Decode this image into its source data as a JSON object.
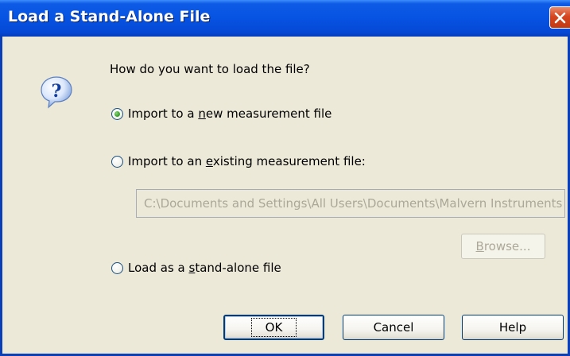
{
  "window": {
    "title": "Load a Stand-Alone File",
    "close_icon": "close-icon"
  },
  "dialog": {
    "icon": "question-icon",
    "prompt": "How do you want to load the file?",
    "options": [
      {
        "pre": "Import to a ",
        "accel": "n",
        "post": "ew measurement file",
        "checked": true
      },
      {
        "pre": "Import to an ",
        "accel": "e",
        "post": "xisting measurement file:",
        "checked": false
      },
      {
        "pre": "Load as a ",
        "accel": "s",
        "post": "tand-alone file",
        "checked": false
      }
    ],
    "path_value": "C:\\Documents and Settings\\All Users\\Documents\\Malvern Instruments",
    "browse": {
      "accel": "B",
      "rest": "rowse..."
    },
    "ok_label": "OK",
    "cancel_label": "Cancel",
    "help_label": "Help"
  },
  "colors": {
    "titlebar": "#0753e2",
    "dialog_bg": "#ece9d8",
    "close_button": "#d6451f"
  }
}
